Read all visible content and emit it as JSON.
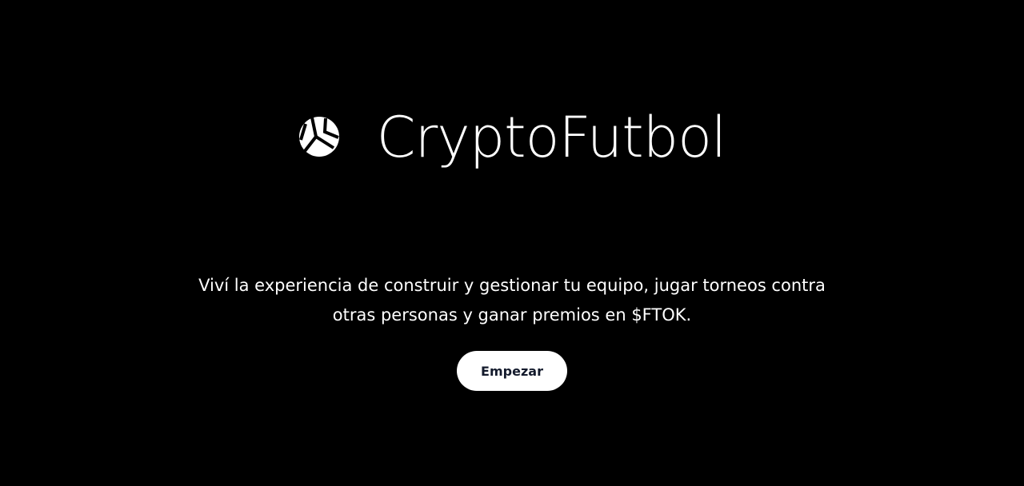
{
  "brand": {
    "name": "CryptoFutbol",
    "logo_icon": "soccer-ball-icon"
  },
  "hero": {
    "tagline": "Viví la experiencia de construir y gestionar tu equipo, jugar torneos contra otras personas y ganar premios en $FTOK.",
    "cta_label": "Empezar"
  },
  "colors": {
    "background": "#000000",
    "text": "#ffffff",
    "button_bg": "#ffffff",
    "button_text": "#141b2d"
  }
}
